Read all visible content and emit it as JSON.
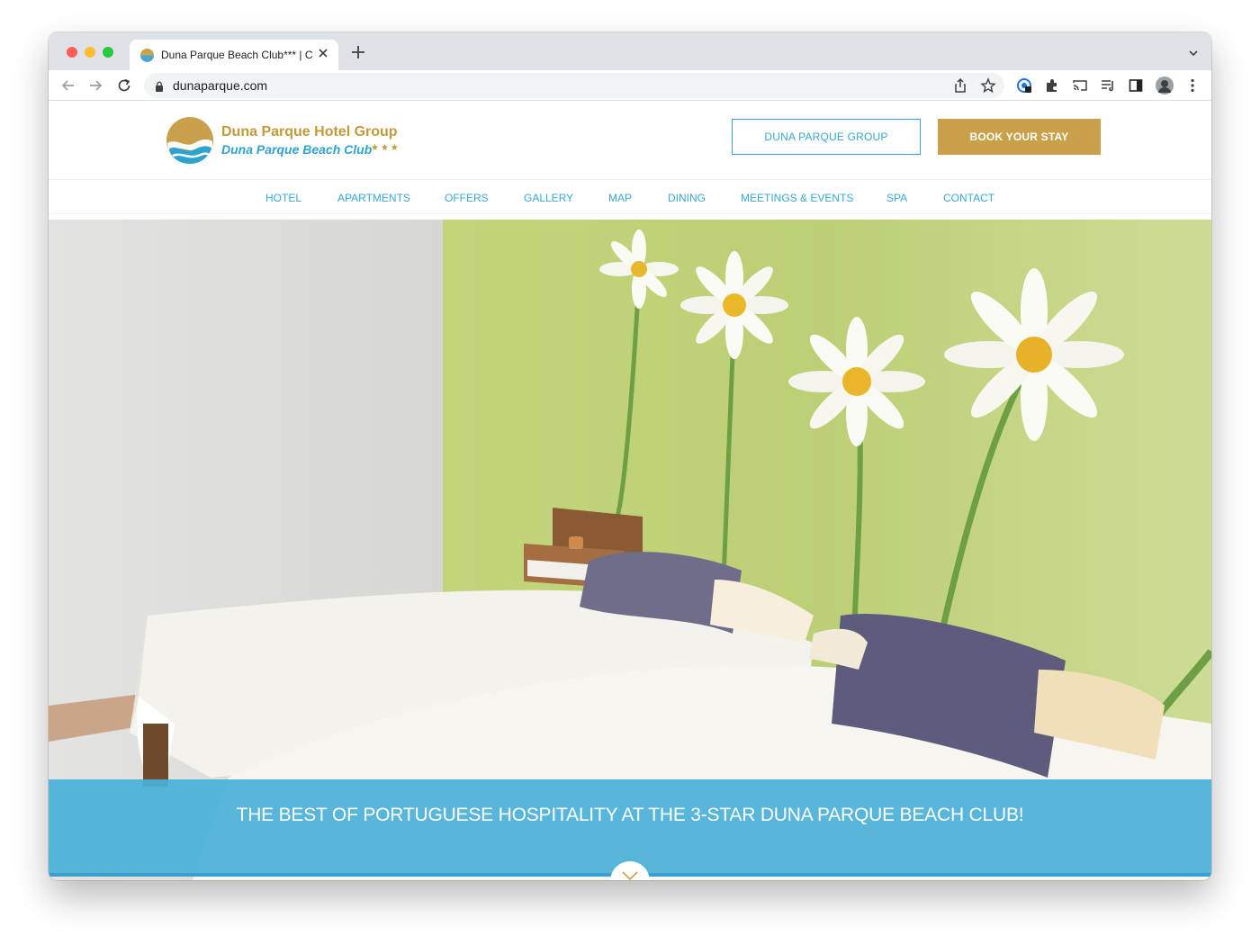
{
  "browser": {
    "tab_title": "Duna Parque Beach Club*** | C",
    "url": "dunaparque.com",
    "icons": [
      "back-icon",
      "forward-icon",
      "reload-icon",
      "lock-icon",
      "share-icon",
      "star-icon",
      "extension-icon",
      "puzzle-icon",
      "cast-icon",
      "reading-list-icon",
      "side-panel-icon",
      "avatar",
      "kebab-menu-icon",
      "chevron-down-icon",
      "new-tab-icon",
      "close-icon"
    ]
  },
  "site": {
    "logo_title": "Duna Parque Hotel Group",
    "logo_subtitle": "Duna Parque Beach Club",
    "logo_stars": "★★★",
    "group_button": "DUNA PARQUE GROUP",
    "book_button": "BOOK YOUR STAY",
    "nav": [
      "HOTEL",
      "APARTMENTS",
      "OFFERS",
      "GALLERY",
      "MAP",
      "DINING",
      "MEETINGS & EVENTS",
      "SPA",
      "CONTACT"
    ]
  },
  "hero": {
    "tagline": "THE BEST OF PORTUGUESE HOSPITALITY AT THE 3-STAR DUNA PARQUE BEACH CLUB!"
  },
  "colors": {
    "brand_gold": "#c9a04c",
    "brand_blue": "#3aa6d2",
    "banner_blue": "#4ab0d8"
  }
}
